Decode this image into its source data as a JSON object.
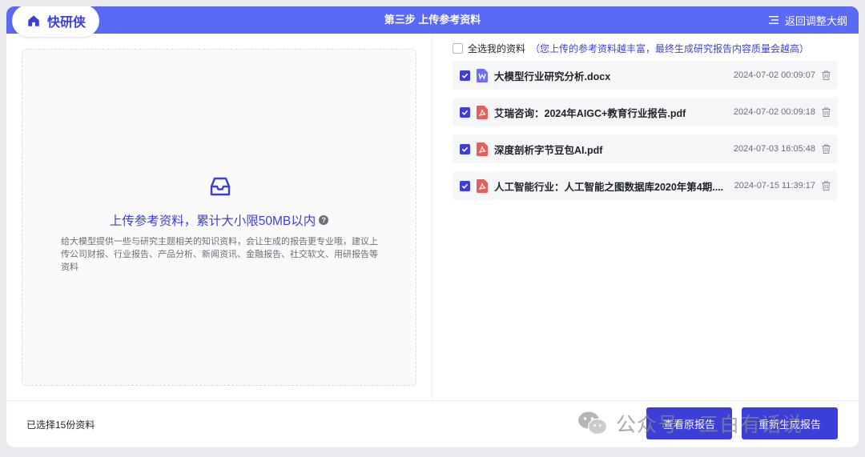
{
  "header": {
    "logo_text": "快研侠",
    "step_title": "第三步 上传参考资料",
    "back_label": "返回调整大纲"
  },
  "upload": {
    "title": "上传参考资料，累计大小限50MB以内",
    "help_glyph": "?",
    "description": "给大模型提供一些与研究主题相关的知识资料，会让生成的报告更专业哦，建议上传公司财报、行业报告、产品分析、新闻资讯、金融报告、社交软文、用研报告等资料"
  },
  "file_panel": {
    "select_all_label": "全选我的资料",
    "select_all_hint": "（您上传的参考资料越丰富，最终生成研究报告内容质量会越高）",
    "select_all_checked": false,
    "files": [
      {
        "name": "大模型行业研究分析.docx",
        "type": "docx",
        "time": "2024-07-02 00:09:07",
        "checked": true
      },
      {
        "name": "艾瑞咨询：2024年AIGC+教育行业报告.pdf",
        "type": "pdf",
        "time": "2024-07-02 00:09:18",
        "checked": true
      },
      {
        "name": "深度剖析字节豆包AI.pdf",
        "type": "pdf",
        "time": "2024-07-03 16:05:48",
        "checked": true
      },
      {
        "name": "人工智能行业：人工智能之图数据库2020年第4期....",
        "type": "pdf",
        "time": "2024-07-15 11:39:17",
        "checked": true
      }
    ]
  },
  "footer": {
    "selected_count": "已选择15份资料",
    "view_button": "查看原报告",
    "regenerate_button": "重新生成报告"
  },
  "watermark": {
    "text": "公众号 · 三白有话说"
  },
  "colors": {
    "accent": "#3b3fd8",
    "topbar": "#5b6af5",
    "docx_icon": "#6b6ff0",
    "pdf_icon": "#e0615c"
  },
  "icons": {
    "logo": "home-icon",
    "back": "menu-lines-icon",
    "upload": "inbox-icon",
    "delete": "trash-icon"
  }
}
